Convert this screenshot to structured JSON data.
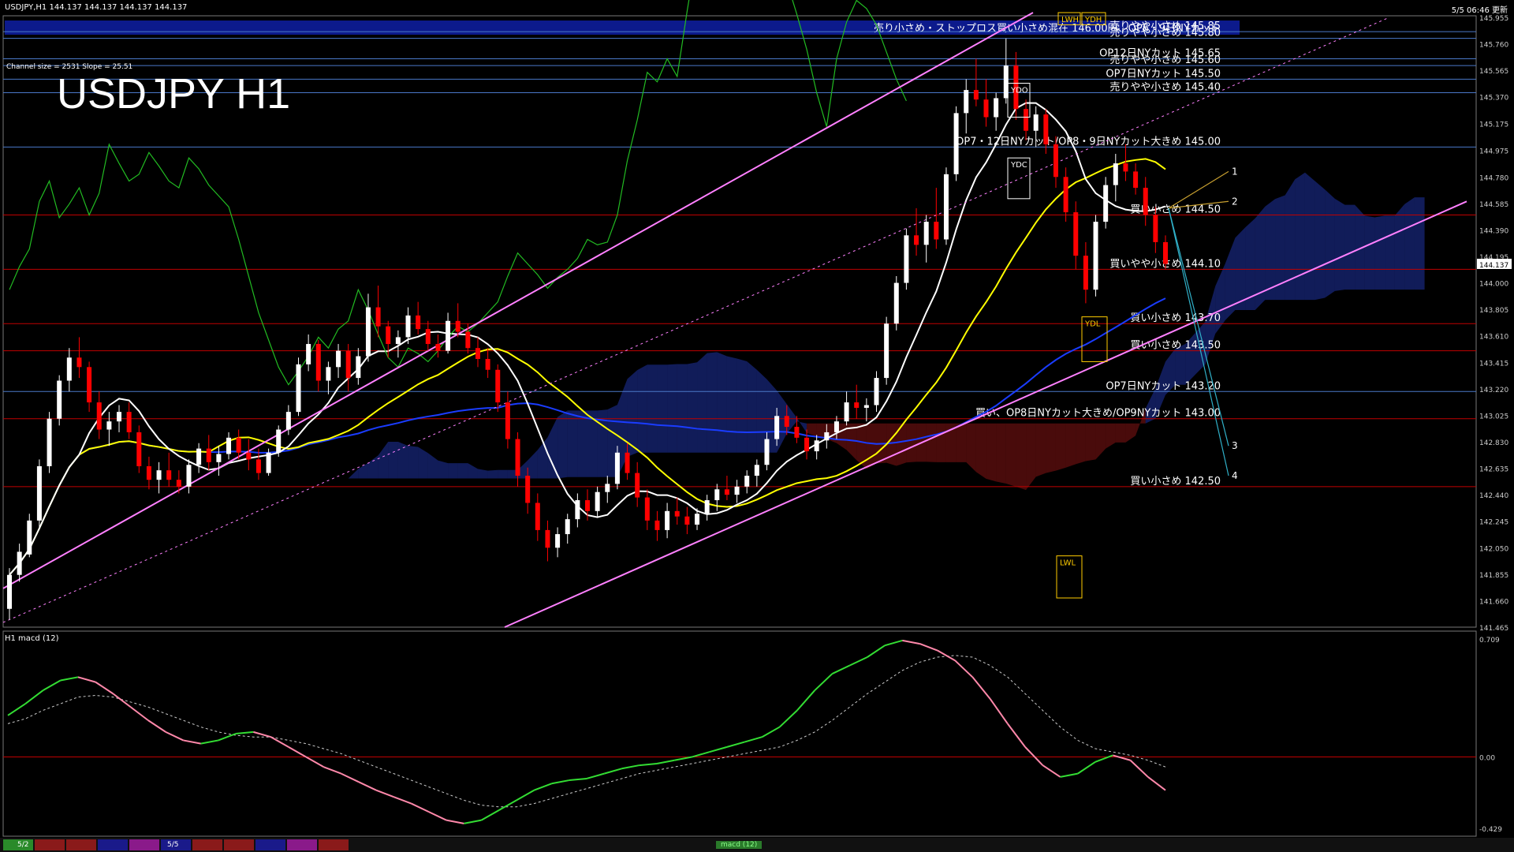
{
  "header": {
    "symbol_line": "USDJPY,H1  144.137 144.137 144.137 144.137",
    "updated": "5/5 06:46 更新",
    "channel_info": "Channel size = 2531 Slope = 25.51",
    "big_title": "USDJPY H1"
  },
  "subwindow": {
    "label": "H1  macd (12)"
  },
  "bottom_bar": {
    "date1": "5/2",
    "date2": "5/5",
    "macd_tab": "macd (12)"
  },
  "colors": {
    "background": "#000000",
    "bull_candle": "#ffffff",
    "bear_candle": "#ff0000",
    "kumo_bull": "#3050ff",
    "kumo_bear": "#d02020",
    "level_red": "#c00000",
    "level_blue": "#4a78c8",
    "channel": "#ff80ff",
    "ma_white": "#ffffff",
    "ma_yellow": "#ffff00",
    "ma_blue": "#1a3cff",
    "chikou": "#22bb22",
    "macd_up": "#33dd33",
    "macd_down": "#ff88aa"
  },
  "chart_data": [
    {
      "type": "candlestick",
      "title": "USDJPY H1",
      "ylim": [
        141.465,
        145.955
      ],
      "y_ticks": [
        "145.955",
        "145.760",
        "145.565",
        "145.370",
        "145.175",
        "144.975",
        "144.780",
        "144.585",
        "144.390",
        "144.195",
        "144.000",
        "143.805",
        "143.610",
        "143.415",
        "143.220",
        "143.025",
        "142.830",
        "142.635",
        "142.440",
        "142.245",
        "142.050",
        "141.855",
        "141.660",
        "141.465"
      ],
      "current_price": "144.137",
      "ohlc": [
        [
          141.6,
          141.9,
          141.52,
          141.85
        ],
        [
          141.85,
          142.08,
          141.8,
          142.02
        ],
        [
          142.0,
          142.3,
          141.98,
          142.25
        ],
        [
          142.25,
          142.7,
          142.2,
          142.65
        ],
        [
          142.65,
          143.05,
          142.6,
          143.0
        ],
        [
          143.0,
          143.32,
          142.95,
          143.28
        ],
        [
          143.28,
          143.52,
          143.2,
          143.45
        ],
        [
          143.45,
          143.6,
          143.3,
          143.38
        ],
        [
          143.38,
          143.42,
          143.05,
          143.12
        ],
        [
          143.12,
          143.2,
          142.85,
          142.92
        ],
        [
          142.92,
          143.05,
          142.8,
          142.98
        ],
        [
          142.98,
          143.1,
          142.9,
          143.05
        ],
        [
          143.05,
          143.12,
          142.85,
          142.9
        ],
        [
          142.9,
          142.95,
          142.6,
          142.65
        ],
        [
          142.65,
          142.72,
          142.48,
          142.55
        ],
        [
          142.55,
          142.68,
          142.45,
          142.62
        ],
        [
          142.62,
          142.75,
          142.5,
          142.55
        ],
        [
          142.55,
          142.62,
          142.45,
          142.5
        ],
        [
          142.5,
          142.7,
          142.45,
          142.66
        ],
        [
          142.66,
          142.82,
          142.6,
          142.78
        ],
        [
          142.78,
          142.88,
          142.62,
          142.68
        ],
        [
          142.68,
          142.8,
          142.58,
          142.74
        ],
        [
          142.74,
          142.9,
          142.7,
          142.86
        ],
        [
          142.86,
          142.92,
          142.7,
          142.75
        ],
        [
          142.75,
          142.85,
          142.62,
          142.7
        ],
        [
          142.7,
          142.78,
          142.55,
          142.6
        ],
        [
          142.6,
          142.78,
          142.58,
          142.75
        ],
        [
          142.75,
          142.95,
          142.72,
          142.92
        ],
        [
          142.92,
          143.1,
          142.88,
          143.05
        ],
        [
          143.05,
          143.45,
          143.02,
          143.4
        ],
        [
          143.4,
          143.62,
          143.35,
          143.55
        ],
        [
          143.55,
          143.58,
          143.2,
          143.28
        ],
        [
          143.28,
          143.42,
          143.18,
          143.38
        ],
        [
          143.38,
          143.55,
          143.3,
          143.5
        ],
        [
          143.5,
          143.55,
          143.2,
          143.3
        ],
        [
          143.3,
          143.52,
          143.25,
          143.46
        ],
        [
          143.46,
          143.92,
          143.42,
          143.82
        ],
        [
          143.82,
          143.98,
          143.6,
          143.68
        ],
        [
          143.68,
          143.72,
          143.45,
          143.55
        ],
        [
          143.55,
          143.65,
          143.45,
          143.6
        ],
        [
          143.6,
          143.82,
          143.55,
          143.76
        ],
        [
          143.76,
          143.86,
          143.62,
          143.66
        ],
        [
          143.66,
          143.72,
          143.5,
          143.55
        ],
        [
          143.55,
          143.62,
          143.45,
          143.5
        ],
        [
          143.5,
          143.78,
          143.48,
          143.72
        ],
        [
          143.72,
          143.85,
          143.6,
          143.64
        ],
        [
          143.64,
          143.7,
          143.48,
          143.52
        ],
        [
          143.52,
          143.6,
          143.38,
          143.44
        ],
        [
          143.44,
          143.52,
          143.3,
          143.36
        ],
        [
          143.36,
          143.4,
          143.05,
          143.12
        ],
        [
          143.12,
          143.2,
          142.78,
          142.85
        ],
        [
          142.85,
          142.9,
          142.5,
          142.58
        ],
        [
          142.58,
          142.64,
          142.3,
          142.38
        ],
        [
          142.38,
          142.45,
          142.1,
          142.18
        ],
        [
          142.18,
          142.25,
          141.95,
          142.05
        ],
        [
          142.05,
          142.2,
          141.98,
          142.15
        ],
        [
          142.15,
          142.3,
          142.08,
          142.26
        ],
        [
          142.26,
          142.45,
          142.2,
          142.4
        ],
        [
          142.4,
          142.48,
          142.25,
          142.32
        ],
        [
          142.32,
          142.5,
          142.28,
          142.46
        ],
        [
          142.46,
          142.58,
          142.38,
          142.52
        ],
        [
          142.52,
          142.8,
          142.48,
          142.75
        ],
        [
          142.75,
          142.82,
          142.55,
          142.6
        ],
        [
          142.6,
          142.68,
          142.35,
          142.42
        ],
        [
          142.42,
          142.48,
          142.18,
          142.25
        ],
        [
          142.25,
          142.32,
          142.1,
          142.18
        ],
        [
          142.18,
          142.38,
          142.12,
          142.32
        ],
        [
          142.32,
          142.42,
          142.22,
          142.28
        ],
        [
          142.28,
          142.35,
          142.15,
          142.22
        ],
        [
          142.22,
          142.34,
          142.18,
          142.3
        ],
        [
          142.3,
          142.44,
          142.25,
          142.4
        ],
        [
          142.4,
          142.52,
          142.32,
          142.48
        ],
        [
          142.48,
          142.58,
          142.4,
          142.44
        ],
        [
          142.44,
          142.55,
          142.38,
          142.5
        ],
        [
          142.5,
          142.62,
          142.45,
          142.58
        ],
        [
          142.58,
          142.7,
          142.5,
          142.66
        ],
        [
          142.66,
          142.9,
          142.62,
          142.85
        ],
        [
          142.85,
          143.08,
          142.8,
          143.02
        ],
        [
          143.02,
          143.1,
          142.88,
          142.94
        ],
        [
          142.94,
          143.02,
          142.82,
          142.86
        ],
        [
          142.86,
          142.92,
          142.7,
          142.76
        ],
        [
          142.76,
          142.88,
          142.7,
          142.84
        ],
        [
          142.84,
          142.96,
          142.78,
          142.9
        ],
        [
          142.9,
          143.02,
          142.85,
          142.98
        ],
        [
          142.98,
          143.2,
          142.95,
          143.12
        ],
        [
          143.12,
          143.25,
          143.0,
          143.08
        ],
        [
          143.08,
          143.15,
          142.98,
          143.1
        ],
        [
          143.1,
          143.35,
          143.05,
          143.3
        ],
        [
          143.3,
          143.75,
          143.25,
          143.7
        ],
        [
          143.7,
          144.05,
          143.65,
          144.0
        ],
        [
          144.0,
          144.4,
          143.95,
          144.35
        ],
        [
          144.35,
          144.55,
          144.2,
          144.28
        ],
        [
          144.28,
          144.5,
          144.15,
          144.45
        ],
        [
          144.45,
          144.7,
          144.25,
          144.32
        ],
        [
          144.32,
          144.85,
          144.28,
          144.8
        ],
        [
          144.8,
          145.3,
          144.75,
          145.25
        ],
        [
          145.25,
          145.5,
          145.1,
          145.42
        ],
        [
          145.42,
          145.65,
          145.3,
          145.35
        ],
        [
          145.35,
          145.5,
          145.15,
          145.22
        ],
        [
          145.22,
          145.4,
          145.12,
          145.36
        ],
        [
          145.36,
          145.8,
          145.32,
          145.6
        ],
        [
          145.6,
          145.7,
          145.2,
          145.28
        ],
        [
          145.28,
          145.35,
          145.05,
          145.12
        ],
        [
          145.12,
          145.3,
          145.0,
          145.24
        ],
        [
          145.24,
          145.28,
          144.95,
          145.02
        ],
        [
          145.02,
          145.08,
          144.7,
          144.78
        ],
        [
          144.78,
          144.85,
          144.45,
          144.52
        ],
        [
          144.52,
          144.6,
          144.1,
          144.2
        ],
        [
          144.2,
          144.3,
          143.85,
          143.95
        ],
        [
          143.95,
          144.5,
          143.9,
          144.45
        ],
        [
          144.45,
          144.78,
          144.4,
          144.72
        ],
        [
          144.72,
          144.95,
          144.6,
          144.88
        ],
        [
          144.88,
          145.02,
          144.75,
          144.82
        ],
        [
          144.82,
          144.88,
          144.65,
          144.7
        ],
        [
          144.7,
          144.78,
          144.42,
          144.5
        ],
        [
          144.5,
          144.56,
          144.22,
          144.3
        ],
        [
          144.3,
          144.35,
          144.1,
          144.14
        ]
      ],
      "price_levels": [
        {
          "price": 145.85,
          "label": "売りやや小さめ 145.85"
        },
        {
          "price": 145.8,
          "label": "売りやや小さめ 145.80"
        },
        {
          "price": 145.65,
          "label": "OP12日NYカット 145.65"
        },
        {
          "price": 145.6,
          "label": "売りやや小さめ 145.60"
        },
        {
          "price": 145.5,
          "label": "OP7日NYカット 145.50"
        },
        {
          "price": 145.4,
          "label": "売りやや小さめ 145.40"
        },
        {
          "price": 145.0,
          "label": "OP7・12日NYカット/OP8・9日NYカット大きめ 145.00"
        },
        {
          "price": 144.5,
          "label": "買い小さめ 144.50"
        },
        {
          "price": 144.1,
          "label": "買いやや小さめ 144.10"
        },
        {
          "price": 143.7,
          "label": "買い小さめ 143.70"
        },
        {
          "price": 143.5,
          "label": "買い小さめ 143.50"
        },
        {
          "price": 143.2,
          "label": "OP7日NYカット 143.20"
        },
        {
          "price": 143.0,
          "label": "買い、OP8日NYカット大きめ/OP9NYカット 143.00"
        },
        {
          "price": 142.5,
          "label": "買い小さめ 142.50"
        }
      ],
      "top_banner": "売り小さめ・ストップロス買い小さめ混在 146.00円、OP6・9日NYカット",
      "boxes": [
        "YDO",
        "YDC",
        "YDL",
        "LWL",
        "LWH",
        "YDH"
      ],
      "projection_labels": [
        "1",
        "2",
        "3",
        "4"
      ],
      "x_dates": [
        "5/2",
        "5/5"
      ]
    },
    {
      "type": "line",
      "title": "H1  macd (12)",
      "ylim": [
        -0.429,
        0.709
      ],
      "y_ticks": [
        "0.709",
        "0.00",
        "-0.429"
      ],
      "series": [
        {
          "values": [
            0.25,
            0.32,
            0.4,
            0.46,
            0.48,
            0.45,
            0.38,
            0.3,
            0.22,
            0.15,
            0.1,
            0.08,
            0.1,
            0.14,
            0.15,
            0.12,
            0.06,
            0.0,
            -0.06,
            -0.1,
            -0.15,
            -0.2,
            -0.24,
            -0.28,
            -0.33,
            -0.38,
            -0.4,
            -0.38,
            -0.32,
            -0.26,
            -0.2,
            -0.16,
            -0.14,
            -0.13,
            -0.1,
            -0.07,
            -0.05,
            -0.04,
            -0.02,
            0.0,
            0.03,
            0.06,
            0.09,
            0.12,
            0.18,
            0.28,
            0.4,
            0.5,
            0.55,
            0.6,
            0.67,
            0.7,
            0.68,
            0.64,
            0.58,
            0.48,
            0.35,
            0.2,
            0.06,
            -0.05,
            -0.12,
            -0.1,
            -0.03,
            0.01,
            -0.02,
            -0.12,
            -0.2
          ]
        },
        {
          "values": [
            0.2,
            0.23,
            0.28,
            0.32,
            0.36,
            0.37,
            0.36,
            0.33,
            0.3,
            0.26,
            0.22,
            0.18,
            0.15,
            0.13,
            0.12,
            0.12,
            0.1,
            0.08,
            0.05,
            0.02,
            -0.02,
            -0.06,
            -0.1,
            -0.14,
            -0.18,
            -0.22,
            -0.26,
            -0.29,
            -0.3,
            -0.3,
            -0.28,
            -0.25,
            -0.22,
            -0.19,
            -0.16,
            -0.13,
            -0.1,
            -0.08,
            -0.06,
            -0.04,
            -0.02,
            0.0,
            0.02,
            0.04,
            0.06,
            0.1,
            0.15,
            0.22,
            0.3,
            0.38,
            0.45,
            0.52,
            0.57,
            0.6,
            0.61,
            0.6,
            0.55,
            0.48,
            0.38,
            0.28,
            0.18,
            0.1,
            0.05,
            0.03,
            0.01,
            -0.02,
            -0.06
          ]
        }
      ],
      "zero_line": "0.00"
    }
  ]
}
